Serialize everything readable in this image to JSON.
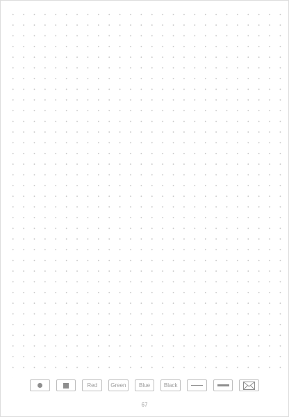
{
  "toolbar": {
    "tools": [
      {
        "name": "dot-tool",
        "icon": "filled-circle-icon"
      },
      {
        "name": "square-tool",
        "icon": "filled-square-icon"
      },
      {
        "name": "red-color",
        "label": "Red"
      },
      {
        "name": "green-color",
        "label": "Green"
      },
      {
        "name": "blue-color",
        "label": "Blue"
      },
      {
        "name": "black-color",
        "label": "Black"
      },
      {
        "name": "thin-line-tool",
        "icon": "thin-line-icon"
      },
      {
        "name": "thick-line-tool",
        "icon": "thick-line-icon"
      },
      {
        "name": "mail-tool",
        "icon": "envelope-icon"
      }
    ],
    "red_label": "Red",
    "green_label": "Green",
    "blue_label": "Blue",
    "black_label": "Black"
  },
  "page": {
    "number": "67"
  }
}
